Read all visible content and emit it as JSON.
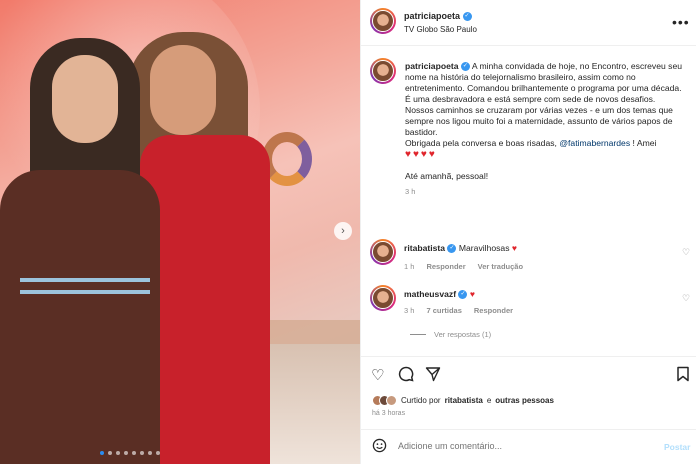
{
  "post": {
    "username": "patriciapoeta",
    "location": "TV Globo São Paulo",
    "more_label": "•••",
    "next_label": "›",
    "caption_user": "patriciapoeta",
    "caption_lines": [
      "A minha convidada de hoje, no Encontro, escreveu seu nome na história do telejornalismo brasileiro, assim como no entretenimento. Comandou brilhantemente o programa por uma década.",
      "É uma desbravadora e está sempre com sede de novos desafios. Nossos caminhos se cruzaram por várias vezes - e um dos temas que sempre nos ligou muito foi a maternidade, assunto de vários papos de bastidor."
    ],
    "caption_thanks": "Obrigada pela conversa e boas risadas,",
    "caption_mention": "@fatimabernardes",
    "caption_thanks_end": "! Amei",
    "caption_hearts": "♥♥♥♥",
    "caption_signoff": "Até amanhã, pessoal!",
    "caption_time": "3 h"
  },
  "comments": [
    {
      "user": "ritabatista",
      "text": "Maravilhosas",
      "emoji": "♥",
      "time": "1 h",
      "reply": "Responder",
      "translate": "Ver tradução",
      "likes": ""
    },
    {
      "user": "matheusvazf",
      "text": "",
      "emoji": "♥",
      "time": "3 h",
      "likes": "7 curtidas",
      "reply": "Responder",
      "translate": ""
    }
  ],
  "view_replies": "Ver respostas (1)",
  "liked_by_prefix": "Curtido por",
  "liked_by_user": "ritabatista",
  "liked_by_suffix": "e",
  "liked_by_others": "outras pessoas",
  "post_age": "há 3 horas",
  "comment_placeholder": "Adicione um comentário...",
  "post_button": "Postar",
  "icons": {
    "like": "heart-icon",
    "comment": "comment-icon",
    "share": "share-icon",
    "save": "bookmark-icon",
    "emoji": "emoji-icon",
    "verified": "verified-badge-icon"
  },
  "carousel": {
    "count": 8,
    "active": 0
  },
  "colors": {
    "verified": "#3897f0",
    "heart": "#e0252c",
    "link": "#00376b",
    "post_btn": "#b2dffc"
  }
}
